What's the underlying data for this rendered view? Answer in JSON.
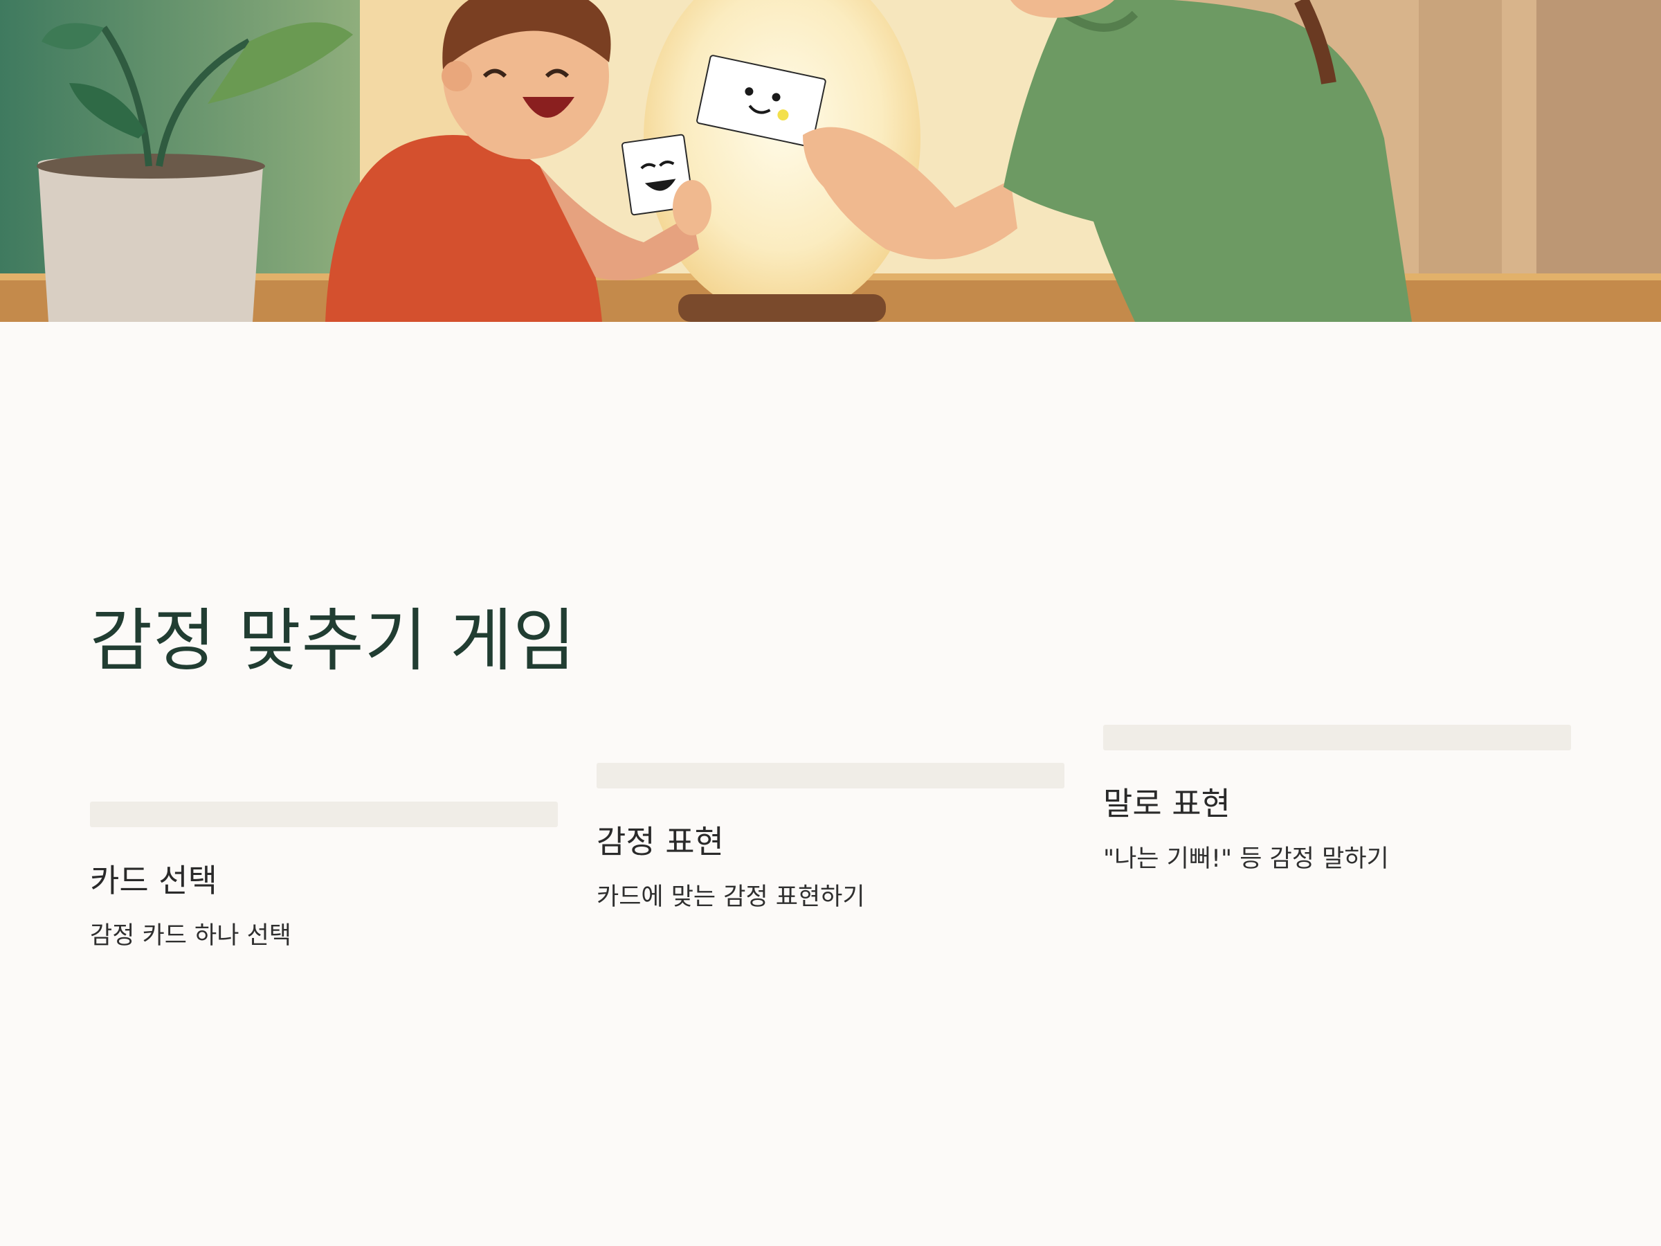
{
  "title": "감정 맞추기 게임",
  "steps": [
    {
      "title": "카드 선택",
      "description": "감정 카드 하나 선택"
    },
    {
      "title": "감정 표현",
      "description": "카드에 맞는 감정 표현하기"
    },
    {
      "title": "말로 표현",
      "description": "\"나는 기뻐!\" 등 감정 말하기"
    }
  ],
  "colors": {
    "background": "#fcfaf8",
    "title": "#213d32",
    "bar": "#f0ede7"
  }
}
